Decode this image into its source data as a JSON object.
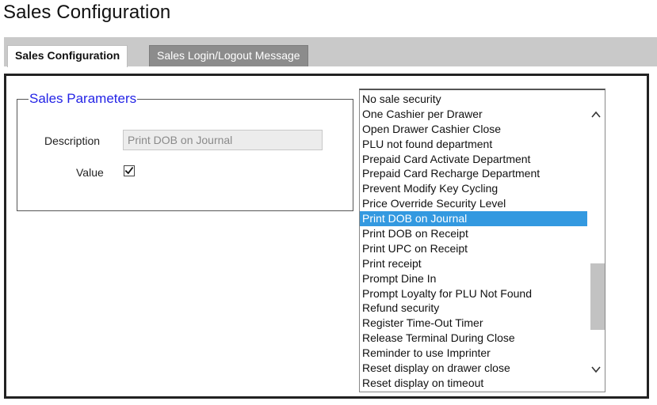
{
  "page": {
    "title": "Sales Configuration"
  },
  "tabs": [
    {
      "label": "Sales Configuration",
      "active": true
    },
    {
      "label": "Sales Login/Logout Message",
      "active": false
    }
  ],
  "sales_parameters": {
    "legend": "Sales Parameters",
    "description_label": "Description",
    "description_value": "Print DOB on Journal",
    "value_label": "Value",
    "value_checked": true
  },
  "parameter_list": {
    "selected_index": 8,
    "items": [
      "No sale security",
      "One Cashier per Drawer",
      "Open Drawer Cashier Close",
      "PLU not found department",
      "Prepaid Card Activate Department",
      "Prepaid Card Recharge Department",
      "Prevent Modify Key Cycling",
      "Price Override Security Level",
      "Print DOB on Journal",
      "Print DOB on Receipt",
      "Print UPC on Receipt",
      "Print receipt",
      "Prompt Dine In",
      "Prompt Loyalty for PLU Not Found",
      "Refund security",
      "Register Time-Out Timer",
      "Release Terminal During Close",
      "Reminder to use Imprinter",
      "Reset display on drawer close",
      "Reset display on timeout"
    ]
  },
  "colors": {
    "selection": "#3399e0",
    "legend": "#2323e6",
    "tab_inactive": "#8c8c8c",
    "tab_bar": "#c9c9c9"
  }
}
